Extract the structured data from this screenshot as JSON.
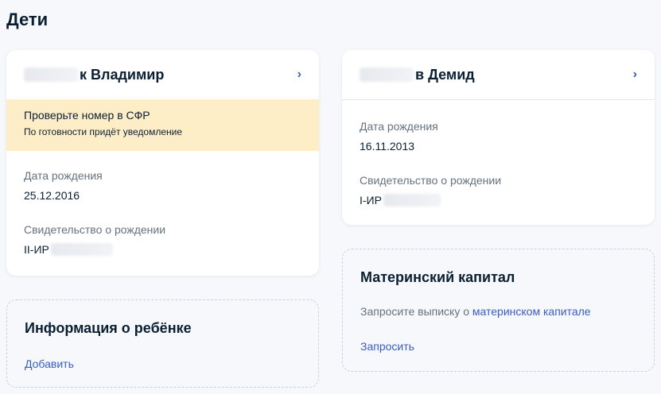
{
  "page": {
    "title": "Дети"
  },
  "child1": {
    "name": "к Владимир",
    "warning_title": "Проверьте номер в СФР",
    "warning_sub": "По готовности придёт уведомление",
    "birth_label": "Дата рождения",
    "birth_value": "25.12.2016",
    "cert_label": "Свидетельство о рождении",
    "cert_series": "II-ИР"
  },
  "child2": {
    "name": "в Демид",
    "birth_label": "Дата рождения",
    "birth_value": "16.11.2013",
    "cert_label": "Свидетельство о рождении",
    "cert_series": "I-ИР"
  },
  "info_card": {
    "title": "Информация о ребёнке",
    "add_label": "Добавить"
  },
  "capital_card": {
    "title": "Материнский капитал",
    "desc_prefix": "Запросите выписку о ",
    "desc_link": "материнском капитале",
    "request_label": "Запросить"
  },
  "icons": {
    "chevron": "chevron-right-icon"
  },
  "colors": {
    "link": "#3b5bc4",
    "warning_bg": "#fdeec7",
    "page_bg": "#f6f8fb"
  }
}
